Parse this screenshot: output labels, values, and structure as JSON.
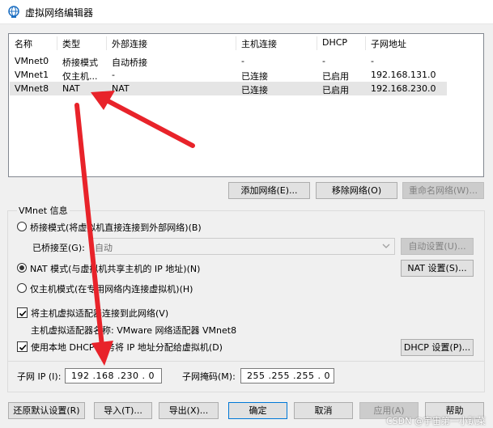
{
  "window": {
    "title": "虚拟网络编辑器"
  },
  "table": {
    "columns": [
      "名称",
      "类型",
      "外部连接",
      "主机连接",
      "DHCP",
      "子网地址"
    ],
    "rows": [
      [
        "VMnet0",
        "桥接模式",
        "自动桥接",
        "-",
        "-",
        "-"
      ],
      [
        "VMnet1",
        "仅主机...",
        "-",
        "已连接",
        "已启用",
        "192.168.131.0"
      ],
      [
        "VMnet8",
        "NAT",
        "NAT",
        "已连接",
        "已启用",
        "192.168.230.0"
      ]
    ]
  },
  "table_buttons": {
    "add": "添加网络(E)...",
    "remove": "移除网络(O)",
    "rename": "重命名网络(W)..."
  },
  "vmnet_info": {
    "legend": "VMnet 信息",
    "bridged_label": "桥接模式(将虚拟机直接连接到外部网络)(B)",
    "bridged_to_label": "已桥接至(G):",
    "bridged_to_value": "自动",
    "auto_settings": "自动设置(U)...",
    "nat_label": "NAT 模式(与虚拟机共享主机的 IP 地址)(N)",
    "nat_settings": "NAT 设置(S)...",
    "hostonly_label": "仅主机模式(在专用网络内连接虚拟机)(H)",
    "connect_adapter_label": "将主机虚拟适配器连接到此网络(V)",
    "adapter_name_label": "主机虚拟适配器名称: VMware 网络适配器 VMnet8",
    "dhcp_label": "使用本地 DHCP 服务将 IP 地址分配给虚拟机(D)",
    "dhcp_settings": "DHCP 设置(P)...",
    "subnet_ip_label": "子网 IP (I):",
    "subnet_ip_value": "192 .168 .230 .  0",
    "subnet_mask_label": "子网掩码(M):",
    "subnet_mask_value": "255 .255 .255 .  0",
    "mode_selected": "nat",
    "connect_adapter_checked": true,
    "dhcp_checked": true
  },
  "footer": {
    "restore": "还原默认设置(R)",
    "import": "导入(T)...",
    "export": "导出(X)...",
    "ok": "确定",
    "cancel": "取消",
    "apply": "应用(A)",
    "help": "帮助"
  },
  "watermark": "CSDN @宇宙第一小趴菜",
  "colors": {
    "arrow": "#e8232a",
    "selection": "#e5e5e5",
    "default_border": "#0078d7"
  }
}
